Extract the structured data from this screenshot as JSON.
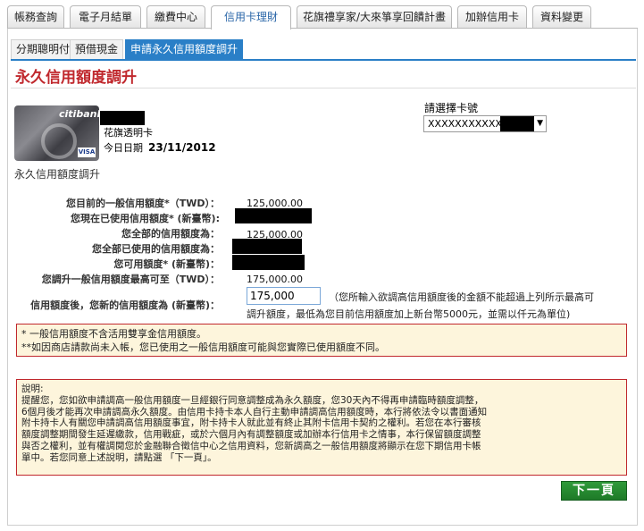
{
  "tabs": [
    {
      "label": "帳務查詢"
    },
    {
      "label": "電子月結單"
    },
    {
      "label": "繳費中心"
    },
    {
      "label": "信用卡理財"
    },
    {
      "label": "花旗禮享家/大來箏享回饋計畫"
    },
    {
      "label": "加辦信用卡"
    },
    {
      "label": "資料變更"
    }
  ],
  "subtabs": [
    {
      "label": "分期聰明付"
    },
    {
      "label": "預借現金"
    },
    {
      "label": "申請永久信用額度調升"
    }
  ],
  "page_title": "永久信用額度調升",
  "card": {
    "bank_logo": "citibank",
    "name": "花旗透明卡",
    "date_label": "今日日期",
    "date_value": "23/11/2012",
    "network": "VISA"
  },
  "section_label": "永久信用額度調升",
  "card_select": {
    "label": "請選擇卡號",
    "value": "XXXXXXXXXXXX"
  },
  "rows": [
    {
      "label": "您目前的一般信用額度*（TWD）：",
      "value": "125,000.00"
    },
    {
      "label": "您現在已使用信用額度* (新臺幣):",
      "value": ""
    },
    {
      "label": "您全部的信用額度為：",
      "value": "125,000.00"
    },
    {
      "label": "您全部已使用的信用額度為：",
      "value": ""
    },
    {
      "label": "您可用額度* (新臺幣)：",
      "value": ""
    },
    {
      "label": "您調升一般信用額度最高可至（TWD）：",
      "value": "175,000.00"
    }
  ],
  "new_limit": {
    "label": "信用額度後，您新的信用額度為 (新臺幣)：",
    "value": "175,000",
    "note1": "（您所輸入欲調高信用額度後的金額不能超過上列所示最高可",
    "note2": "調升額度，最低為您目前信用額度加上新台幣5000元，並需以仟元為單位)"
  },
  "notice": {
    "line1": "* 一般信用額度不含活用雙享金信用額度。",
    "line2": "**如因商店請款尚未入帳，您已使用之一般信用額度可能與您實際已使用額度不同。"
  },
  "explain": {
    "title": "說明:",
    "lines": [
      "提醒您，您如欲申請調高一般信用額度一旦經銀行同意調整成為永久額度，您30天內不得再申請臨時額度調整，",
      "6個月後才能再次申請調高永久額度。由信用卡持卡本人自行主動申請調高信用額度時，本行將依法令以書面通知",
      "附卡持卡人有關您申請調高信用額度事宜，附卡持卡人就此並有終止其附卡信用卡契約之權利。若您在本行審核",
      "額度調整期間發生延遲繳款，信用戰疵，或於六個月內有調整額度或加辦本行信用卡之情事，本行保留額度調整",
      "與否之權利，並有權調閱您於金融聯合徵信中心之信用資料，您新調高之一般信用額度將顯示在您下期信用卡帳",
      "單中。若您同意上述說明，請點選 「下一頁」。"
    ]
  },
  "next_button": "下一頁",
  "colors": {
    "accent": "#2a7fc7",
    "title_red": "#c0282d",
    "notice_bg": "#fdf5dc",
    "next_green": "#1e7a28"
  }
}
